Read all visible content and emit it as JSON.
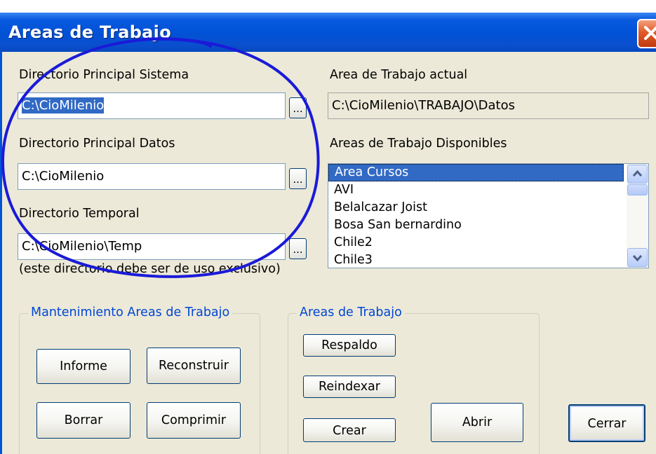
{
  "window": {
    "title": "Areas de Trabajo",
    "close": "×"
  },
  "fields": {
    "sistema": {
      "label": "Directorio Principal Sistema",
      "value": "C:\\CioMilenio",
      "browse": "..."
    },
    "datos": {
      "label": "Directorio Principal Datos",
      "value": "C:\\CioMilenio",
      "browse": "..."
    },
    "temporal": {
      "label": "Directorio Temporal",
      "value": "C:\\CioMilenio\\Temp",
      "browse": "...",
      "note": "(este directorio debe ser de uso exclusivo)"
    }
  },
  "current_area": {
    "label": "Area de Trabajo actual",
    "value": "C:\\CioMilenio\\TRABAJO\\Datos"
  },
  "available": {
    "label": "Areas de Trabajo Disponibles",
    "items": [
      "Area Cursos",
      "AVI",
      "Belalcazar Joist",
      "Bosa San bernardino",
      "Chile2",
      "Chile3"
    ],
    "selected": "Area Cursos"
  },
  "maintenance": {
    "title": "Mantenimiento Areas de Trabajo",
    "informe": "Informe",
    "reconstruir": "Reconstruir",
    "borrar": "Borrar",
    "comprimir": "Comprimir"
  },
  "areas": {
    "title": "Areas de Trabajo",
    "respaldo": "Respaldo",
    "reindexar": "Reindexar",
    "crear": "Crear",
    "abrir": "Abrir"
  },
  "cerrar": "Cerrar",
  "colors": {
    "titlebar": "#0052d6",
    "selection": "#316ac5",
    "group_title": "#0046d5",
    "annotation": "#1a1ad8"
  }
}
